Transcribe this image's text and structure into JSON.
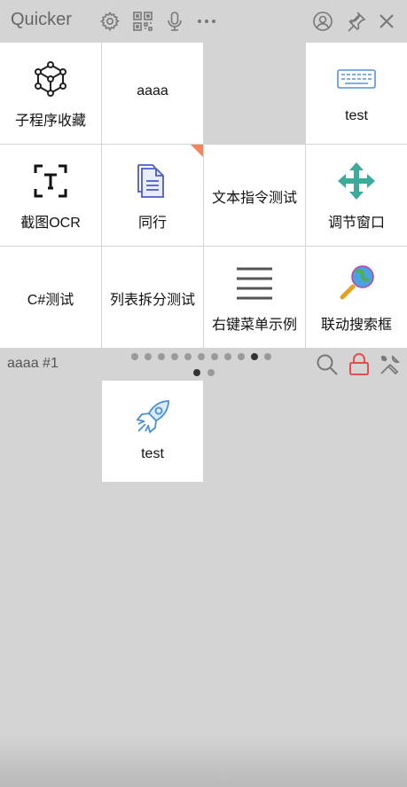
{
  "app": {
    "title": "Quicker"
  },
  "toolbar_icons": [
    "gear-icon",
    "qr-code-icon",
    "microphone-icon",
    "more-icon",
    "user-icon",
    "pin-icon",
    "close-icon"
  ],
  "grid": {
    "cells": [
      {
        "label": "子程序收藏",
        "icon": "cube-network-icon"
      },
      {
        "label": "aaaa",
        "icon": ""
      },
      {
        "label": "",
        "icon": ""
      },
      {
        "label": "test",
        "icon": "keyboard-icon"
      },
      {
        "label": "截图OCR",
        "icon": "ocr-text-icon",
        "flag": true
      },
      {
        "label": "同行",
        "icon": "document-copy-icon",
        "flag": true
      },
      {
        "label": "文本指令测试",
        "icon": ""
      },
      {
        "label": "调节窗口",
        "icon": "move-arrows-icon"
      },
      {
        "label": "C#测试",
        "icon": ""
      },
      {
        "label": "列表拆分测试",
        "icon": ""
      },
      {
        "label": "右键菜单示例",
        "icon": "menu-lines-icon"
      },
      {
        "label": "联动搜索框",
        "icon": "globe-search-icon"
      }
    ]
  },
  "pager": {
    "label": "aaaa #1",
    "dot_count": 11,
    "active_dot": 10,
    "row2_dot_count": 2,
    "row2_active_dot": 1
  },
  "lower_panel": {
    "cells": [
      {
        "label": "test",
        "icon": "rocket-icon"
      }
    ]
  },
  "colors": {
    "accent_corner": "#f5845a",
    "lock_red": "#e05050",
    "icon_blue": "#5b8fd8",
    "icon_teal": "#3aaa9a"
  }
}
